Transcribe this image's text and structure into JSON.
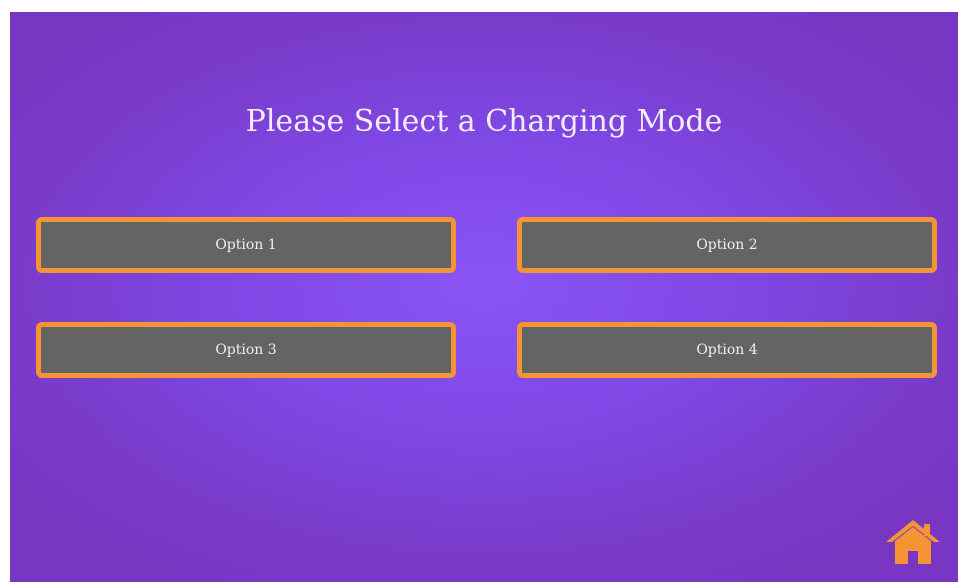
{
  "screen": {
    "title": "Please Select a Charging Mode",
    "background_color": "#8a55f5",
    "accent_color": "#f59434"
  },
  "options": [
    {
      "label": "Option 1"
    },
    {
      "label": "Option 2"
    },
    {
      "label": "Option 3"
    },
    {
      "label": "Option 4"
    }
  ],
  "home_button": {
    "icon": "home-icon",
    "color": "#f59434"
  }
}
